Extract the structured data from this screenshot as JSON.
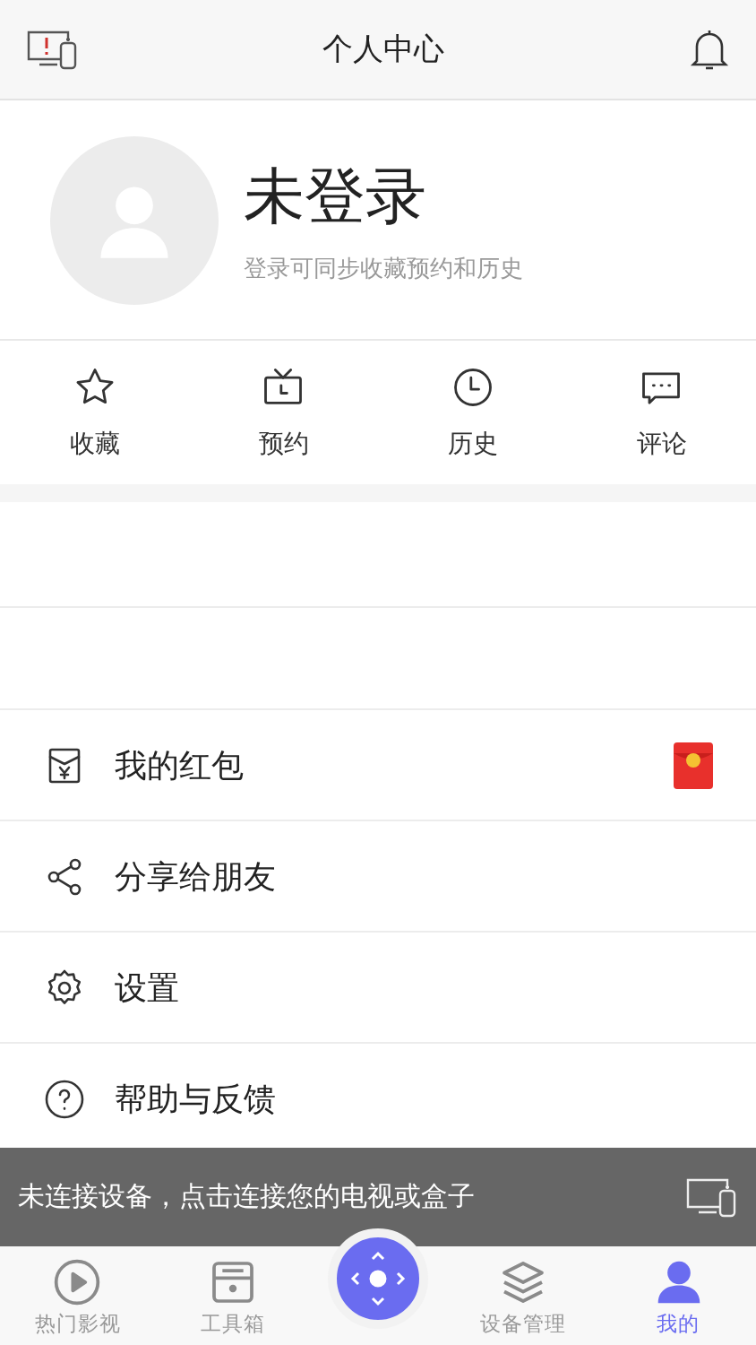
{
  "header": {
    "title": "个人中心"
  },
  "profile": {
    "name": "未登录",
    "hint": "登录可同步收藏预约和历史"
  },
  "shortcuts": [
    {
      "kind": "star",
      "label": "收藏"
    },
    {
      "kind": "tv",
      "label": "预约"
    },
    {
      "kind": "clock",
      "label": "历史"
    },
    {
      "kind": "comment",
      "label": "评论"
    }
  ],
  "menu": [
    {
      "kind": "envelope",
      "label": "我的红包",
      "badge": true
    },
    {
      "kind": "share",
      "label": "分享给朋友",
      "badge": false
    },
    {
      "kind": "gear",
      "label": "设置",
      "badge": false
    },
    {
      "kind": "help",
      "label": "帮助与反馈",
      "badge": false
    }
  ],
  "toast": {
    "text": "未连接设备，点击连接您的电视或盒子"
  },
  "tabs": [
    {
      "kind": "play",
      "label": "热门影视",
      "selected": false
    },
    {
      "kind": "box",
      "label": "工具箱",
      "selected": false
    },
    {
      "kind": "remote",
      "selected": false
    },
    {
      "kind": "layers",
      "label": "设备管理",
      "selected": false
    },
    {
      "kind": "person",
      "label": "我的",
      "selected": true
    }
  ]
}
